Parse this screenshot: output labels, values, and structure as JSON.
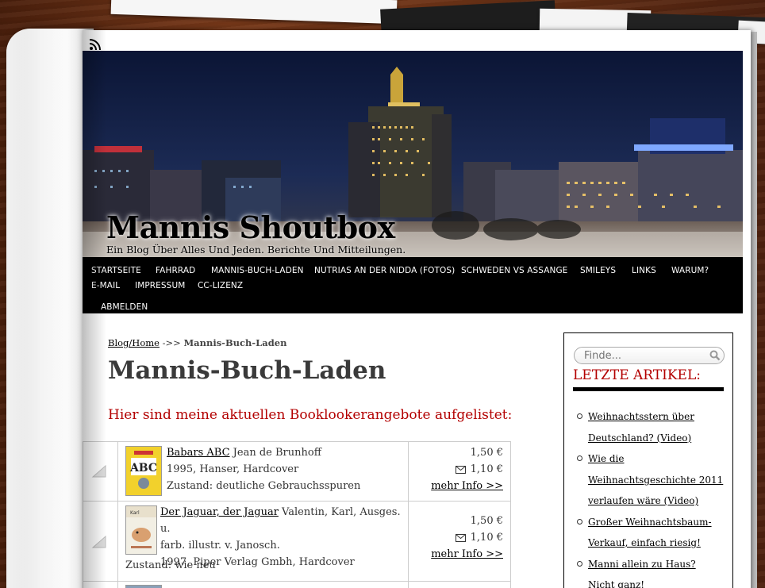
{
  "site": {
    "title": "Mannis Shoutbox",
    "tagline": "Ein Blog Über Alles Und Jeden. Berichte Und Mitteilungen."
  },
  "nav": {
    "items": [
      {
        "label": "STARTSEITE"
      },
      {
        "label": "FAHRRAD"
      },
      {
        "label": "MANNIS-BUCH-LADEN"
      },
      {
        "label": "NUTRIAS AN DER NIDDA (FOTOS)"
      },
      {
        "label": "SCHWEDEN VS ASSANGE"
      },
      {
        "label": "SMILEYS"
      },
      {
        "label": "LINKS"
      },
      {
        "label": "WARUM?"
      },
      {
        "label": "E-MAIL"
      },
      {
        "label": "IMPRESSUM"
      },
      {
        "label": "CC-LIZENZ"
      },
      {
        "label": "ABMELDEN"
      }
    ]
  },
  "breadcrumb": {
    "home": "Blog/Home",
    "separator": "->>",
    "current": "Mannis-Buch-Laden"
  },
  "page": {
    "title": "Mannis-Buch-Laden",
    "intro": "Hier sind meine aktuellen Booklookerangebote aufgelistet:"
  },
  "books": [
    {
      "title": "Babars ABC",
      "author": "Jean de Brunhoff",
      "details": "1995, Hanser, Hardcover",
      "condition": "Zustand: deutliche Gebrauchsspuren",
      "price": "1,50 €",
      "shipping": "1,10 €",
      "more": "mehr Info >>"
    },
    {
      "title": "Der Jaguar, der Jaguar",
      "author": "Valentin, Karl, Ausges. u.",
      "author_cont": "farb. illustr. v. Janosch.",
      "details": "1997, Piper Verlag Gmbh, Hardcover",
      "condition": "Zustand: wie neu",
      "price": "1,50 €",
      "shipping": "1,10 €",
      "more": "mehr Info >>"
    }
  ],
  "sidebar": {
    "search_placeholder": "Finde...",
    "widget_title": "LETZTE ARTIKEL:",
    "posts": [
      {
        "title": "Weihnachtsstern über Deutschland? (Video)"
      },
      {
        "title": "Wie die Weihnachtsgeschichte 2011 verlaufen wäre (Video)"
      },
      {
        "title": "Großer Weihnachtsbaum-Verkauf, einfach riesig!"
      },
      {
        "title": "Manni allein zu Haus? Nicht ganz!"
      }
    ]
  },
  "colors": {
    "accent_red": "#b30000",
    "nav_bg": "#000000",
    "wood": "#6b3216"
  }
}
